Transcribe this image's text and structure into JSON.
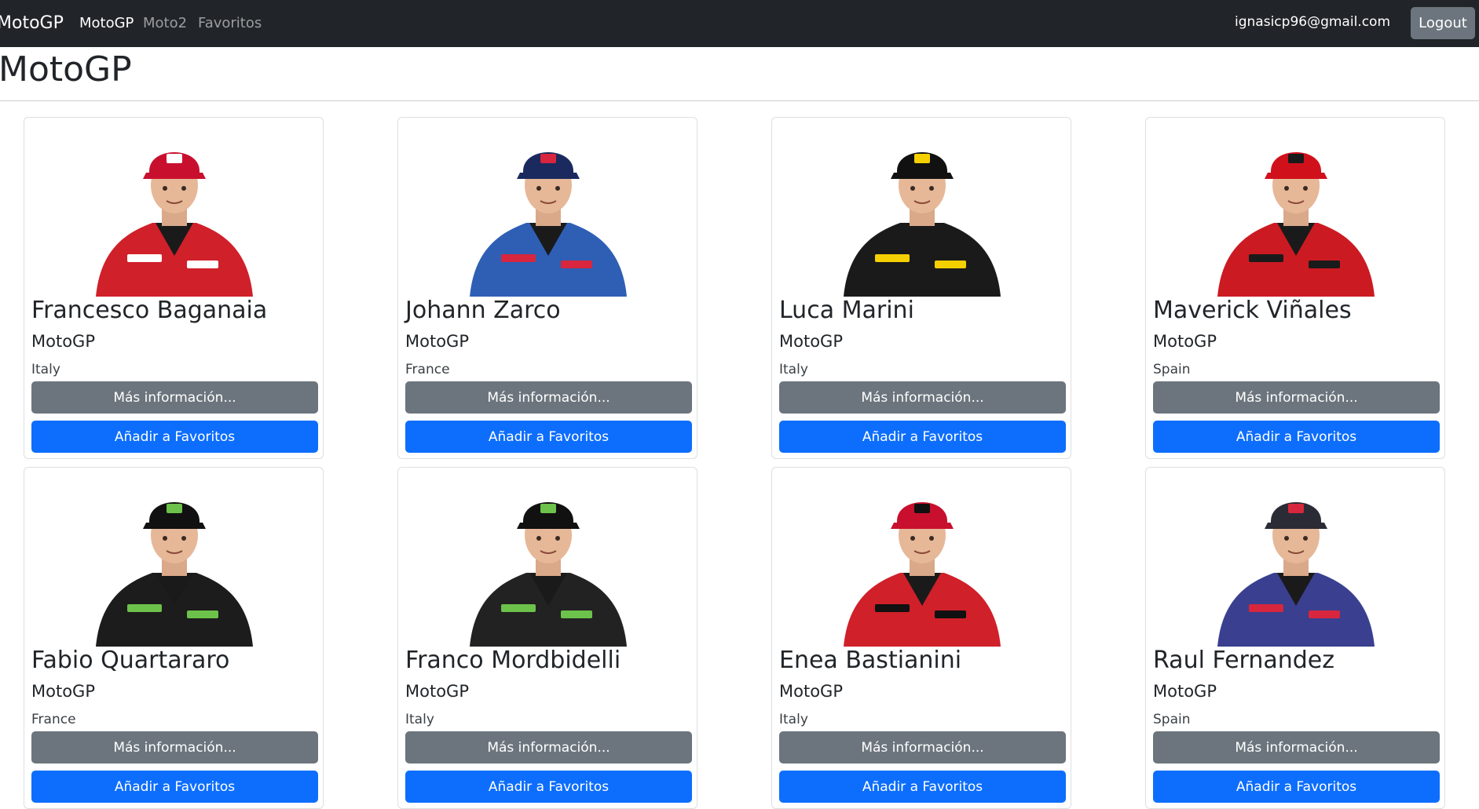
{
  "navbar": {
    "brand": "MotoGP",
    "links": [
      {
        "label": "MotoGP",
        "active": true
      },
      {
        "label": "Moto2",
        "active": false
      },
      {
        "label": "Favoritos",
        "active": false
      }
    ],
    "user_email": "ignasicp96@gmail.com",
    "logout_label": "Logout"
  },
  "page": {
    "title": "MotoGP"
  },
  "buttons": {
    "info_label": "Más información...",
    "fav_label": "Añadir a Favoritos"
  },
  "riders": [
    {
      "name": "Francesco Baganaia",
      "category": "MotoGP",
      "country": "Italy",
      "helmet_cap": "red",
      "suit": "red",
      "cap_color": "#c8102e",
      "suit_color": "#d0202a",
      "accent_color": "#ffffff",
      "icon": "rider-photo"
    },
    {
      "name": "Johann Zarco",
      "category": "MotoGP",
      "country": "France",
      "cap_color": "#1b2a5e",
      "suit_color": "#2e5fb5",
      "accent_color": "#d7263d",
      "icon": "rider-photo"
    },
    {
      "name": "Luca Marini",
      "category": "MotoGP",
      "country": "Italy",
      "cap_color": "#111111",
      "suit_color": "#1a1a1a",
      "accent_color": "#f5d000",
      "icon": "rider-photo"
    },
    {
      "name": "Maverick Viñales",
      "category": "MotoGP",
      "country": "Spain",
      "cap_color": "#d0101b",
      "suit_color": "#cc1a22",
      "accent_color": "#1a1a1a",
      "icon": "rider-photo"
    },
    {
      "name": "Fabio Quartararo",
      "category": "MotoGP",
      "country": "France",
      "cap_color": "#111111",
      "suit_color": "#1c1c1c",
      "accent_color": "#6cc24a",
      "icon": "rider-photo"
    },
    {
      "name": "Franco Mordbidelli",
      "category": "MotoGP",
      "country": "Italy",
      "cap_color": "#111111",
      "suit_color": "#222222",
      "accent_color": "#6cc24a",
      "icon": "rider-photo"
    },
    {
      "name": "Enea Bastianini",
      "category": "MotoGP",
      "country": "Italy",
      "cap_color": "#c8102e",
      "suit_color": "#d0202a",
      "accent_color": "#111111",
      "icon": "rider-photo"
    },
    {
      "name": "Raul Fernandez",
      "category": "MotoGP",
      "country": "Spain",
      "cap_color": "#2b2b35",
      "suit_color": "#3a3f8f",
      "accent_color": "#d7263d",
      "icon": "rider-photo"
    }
  ]
}
